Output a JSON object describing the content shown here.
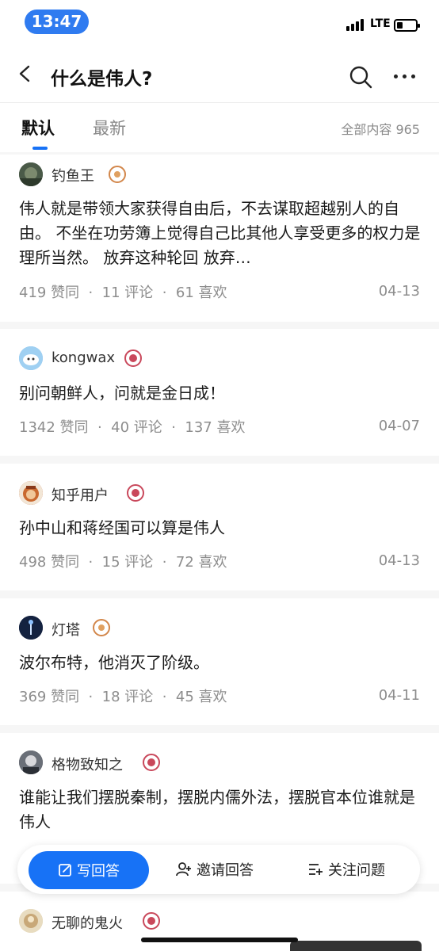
{
  "status": {
    "time": "13:47",
    "network": "LTE"
  },
  "nav": {
    "title": "什么是伟人?"
  },
  "tabs": {
    "default": "默认",
    "latest": "最新",
    "count_label": "全部内容 965"
  },
  "answers": [
    {
      "author": "钓鱼王",
      "badge": "gold",
      "content": "伟人就是带领大家获得自由后，不去谋取超越别人的自由。 不坐在功劳簿上觉得自己比其他人享受更多的权力是理所当然。 放弃这种轮回 放弃…",
      "meta": "419 赞同  ·  11 评论  ·  61 喜欢",
      "date": "04-13"
    },
    {
      "author": "kongwax",
      "badge": "red",
      "content": "别问朝鲜人，问就是金日成！",
      "meta": "1342 赞同  ·  40 评论  ·  137 喜欢",
      "date": "04-07"
    },
    {
      "author": "知乎用户",
      "badge": "red",
      "content": "孙中山和蒋经国可以算是伟人",
      "meta": "498 赞同  ·  15 评论  ·  72 喜欢",
      "date": "04-13"
    },
    {
      "author": "灯塔",
      "badge": "gold",
      "content": "波尔布特，他消灭了阶级。",
      "meta": "369 赞同  ·  18 评论  ·  45 喜欢",
      "date": "04-11"
    },
    {
      "author": "格物致知之",
      "badge": "red",
      "content": "谁能让我们摆脱秦制，摆脱内儒外法，摆脱官本位谁就是伟人",
      "meta": "",
      "date": ""
    },
    {
      "author": "无聊的鬼火",
      "badge": "red",
      "content": "",
      "meta": "",
      "date": ""
    }
  ],
  "actions": {
    "write": "写回答",
    "invite": "邀请回答",
    "follow": "关注问题"
  },
  "colors": {
    "accent": "#1772f6",
    "time_pill": "#2f7bf0"
  }
}
